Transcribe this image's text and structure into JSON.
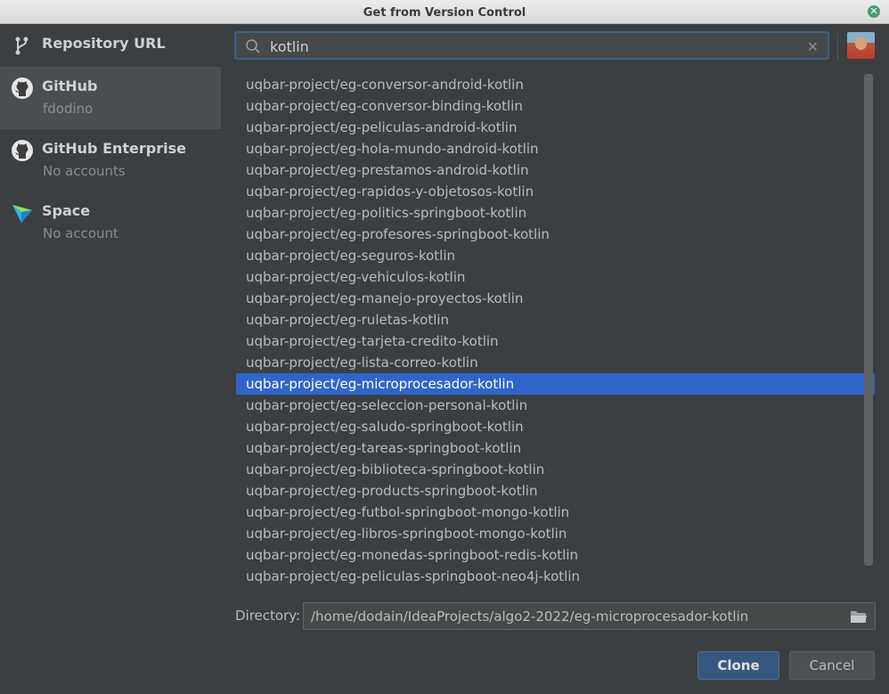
{
  "window": {
    "title": "Get from Version Control"
  },
  "sidebar": {
    "items": [
      {
        "label": "Repository URL",
        "sub": "",
        "icon": "branch-icon"
      },
      {
        "label": "GitHub",
        "sub": "fdodino",
        "icon": "github-icon"
      },
      {
        "label": "GitHub Enterprise",
        "sub": "No accounts",
        "icon": "github-icon"
      },
      {
        "label": "Space",
        "sub": "No account",
        "icon": "space-icon"
      }
    ],
    "selected_index": 1
  },
  "search": {
    "value": "kotlin",
    "placeholder": ""
  },
  "repos": [
    "uqbar-project/eg-conversor-android-kotlin",
    "uqbar-project/eg-conversor-binding-kotlin",
    "uqbar-project/eg-peliculas-android-kotlin",
    "uqbar-project/eg-hola-mundo-android-kotlin",
    "uqbar-project/eg-prestamos-android-kotlin",
    "uqbar-project/eg-rapidos-y-objetosos-kotlin",
    "uqbar-project/eg-politics-springboot-kotlin",
    "uqbar-project/eg-profesores-springboot-kotlin",
    "uqbar-project/eg-seguros-kotlin",
    "uqbar-project/eg-vehiculos-kotlin",
    "uqbar-project/eg-manejo-proyectos-kotlin",
    "uqbar-project/eg-ruletas-kotlin",
    "uqbar-project/eg-tarjeta-credito-kotlin",
    "uqbar-project/eg-lista-correo-kotlin",
    "uqbar-project/eg-microprocesador-kotlin",
    "uqbar-project/eg-seleccion-personal-kotlin",
    "uqbar-project/eg-saludo-springboot-kotlin",
    "uqbar-project/eg-tareas-springboot-kotlin",
    "uqbar-project/eg-biblioteca-springboot-kotlin",
    "uqbar-project/eg-products-springboot-kotlin",
    "uqbar-project/eg-futbol-springboot-mongo-kotlin",
    "uqbar-project/eg-libros-springboot-mongo-kotlin",
    "uqbar-project/eg-monedas-springboot-redis-kotlin",
    "uqbar-project/eg-peliculas-springboot-neo4j-kotlin"
  ],
  "selected_repo_index": 14,
  "directory": {
    "label": "Directory:",
    "value": "/home/dodain/IdeaProjects/algo2-2022/eg-microprocesador-kotlin"
  },
  "buttons": {
    "clone": "Clone",
    "cancel": "Cancel"
  }
}
